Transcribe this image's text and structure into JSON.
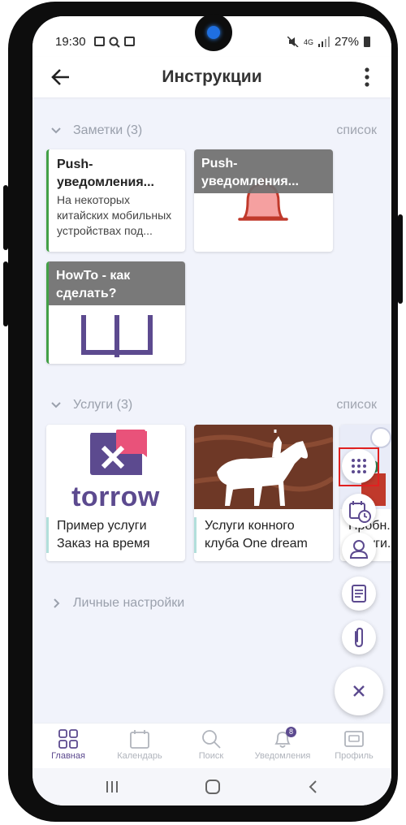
{
  "status_bar": {
    "time": "19:30",
    "network": "4G",
    "battery": "27%"
  },
  "app_bar": {
    "title": "Инструкции",
    "back_icon": "arrow-left-icon",
    "menu_icon": "more-vertical-icon"
  },
  "sections": {
    "notes": {
      "title": "Заметки (3)",
      "link": "список",
      "cards": [
        {
          "title": "Push-уведомления...",
          "body": "На некоторых китайских мобильных устройствах под..."
        },
        {
          "title": "Push-уведомления...",
          "image": "bell-icon"
        },
        {
          "title": "HowTo - как сделать?",
          "image": "book-icon"
        }
      ]
    },
    "services": {
      "title": "Услуги (3)",
      "link": "список",
      "cards": [
        {
          "logo_text": "torrow",
          "caption": "Пример услуги Заказ на время"
        },
        {
          "caption": "Услуги конного клуба One dream",
          "image": "horse-rider-image"
        },
        {
          "caption": "Пробн... услуги...",
          "image": "illustration-image"
        }
      ]
    },
    "personal": {
      "title": "Личные настройки"
    }
  },
  "fab_menu": {
    "items": [
      "grid-dots-icon",
      "calendar-clock-icon",
      "person-icon",
      "document-icon",
      "paperclip-icon"
    ],
    "close_icon": "close-icon"
  },
  "bottom_nav": {
    "items": [
      {
        "label": "Главная",
        "icon": "grid-icon",
        "active": true
      },
      {
        "label": "Календарь",
        "icon": "calendar-icon"
      },
      {
        "label": "Поиск",
        "icon": "search-icon"
      },
      {
        "label": "Уведомления",
        "icon": "bell-icon",
        "badge": "8"
      },
      {
        "label": "Профиль",
        "icon": "profile-card-icon"
      }
    ]
  },
  "colors": {
    "accent": "#5c4a8f",
    "background": "#f1f3fb",
    "note_border": "#43a047",
    "bell": "#c0392b",
    "torrow_pink": "#e9527a",
    "horse_bg": "#7a3f2a"
  }
}
